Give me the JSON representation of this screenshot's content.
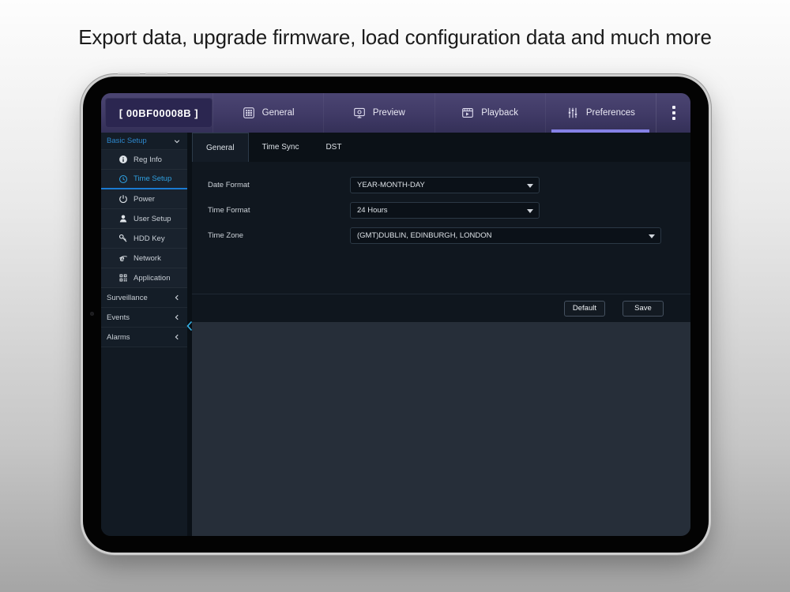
{
  "page": {
    "headline": "Export data, upgrade firmware, load configuration data and much more"
  },
  "app": {
    "device_id": "[ 00BF00008B ]",
    "nav_tabs": [
      {
        "label": "General",
        "icon": "general-icon",
        "active": false
      },
      {
        "label": "Preview",
        "icon": "preview-icon",
        "active": false
      },
      {
        "label": "Playback",
        "icon": "playback-icon",
        "active": false
      },
      {
        "label": "Preferences",
        "icon": "preferences-icon",
        "active": true
      }
    ],
    "sidebar": {
      "items": [
        {
          "label": "Basic Setup",
          "type": "group",
          "state": "expanded",
          "accent": true
        },
        {
          "label": "Reg Info",
          "type": "item",
          "icon": "info-icon"
        },
        {
          "label": "Time Setup",
          "type": "item",
          "icon": "clock-icon",
          "active": true
        },
        {
          "label": "Power",
          "type": "item",
          "icon": "power-icon"
        },
        {
          "label": "User Setup",
          "type": "item",
          "icon": "user-icon"
        },
        {
          "label": "HDD Key",
          "type": "item",
          "icon": "key-icon"
        },
        {
          "label": "Network",
          "type": "item",
          "icon": "network-icon"
        },
        {
          "label": "Application",
          "type": "item",
          "icon": "application-icon"
        },
        {
          "label": "Surveillance",
          "type": "group",
          "state": "collapsed"
        },
        {
          "label": "Events",
          "type": "group",
          "state": "collapsed"
        },
        {
          "label": "Alarms",
          "type": "group",
          "state": "collapsed"
        }
      ]
    },
    "content": {
      "tabs": [
        {
          "label": "General",
          "active": true
        },
        {
          "label": "Time Sync",
          "active": false
        },
        {
          "label": "DST",
          "active": false
        }
      ],
      "form": {
        "rows": [
          {
            "label": "Date Format",
            "value": "YEAR-MONTH-DAY"
          },
          {
            "label": "Time Format",
            "value": "24 Hours"
          },
          {
            "label": "Time Zone",
            "value": "(GMT)DUBLIN, EDINBURGH, LONDON"
          }
        ]
      },
      "buttons": {
        "default_label": "Default",
        "save_label": "Save"
      }
    },
    "colors": {
      "accent_blue": "#2f9fe0",
      "active_border": "#1a7ad2",
      "nav_underline": "#8581e6",
      "navbar_purple": "#403a66",
      "panel_dark": "#10171f",
      "panel_light": "#262e39"
    }
  }
}
